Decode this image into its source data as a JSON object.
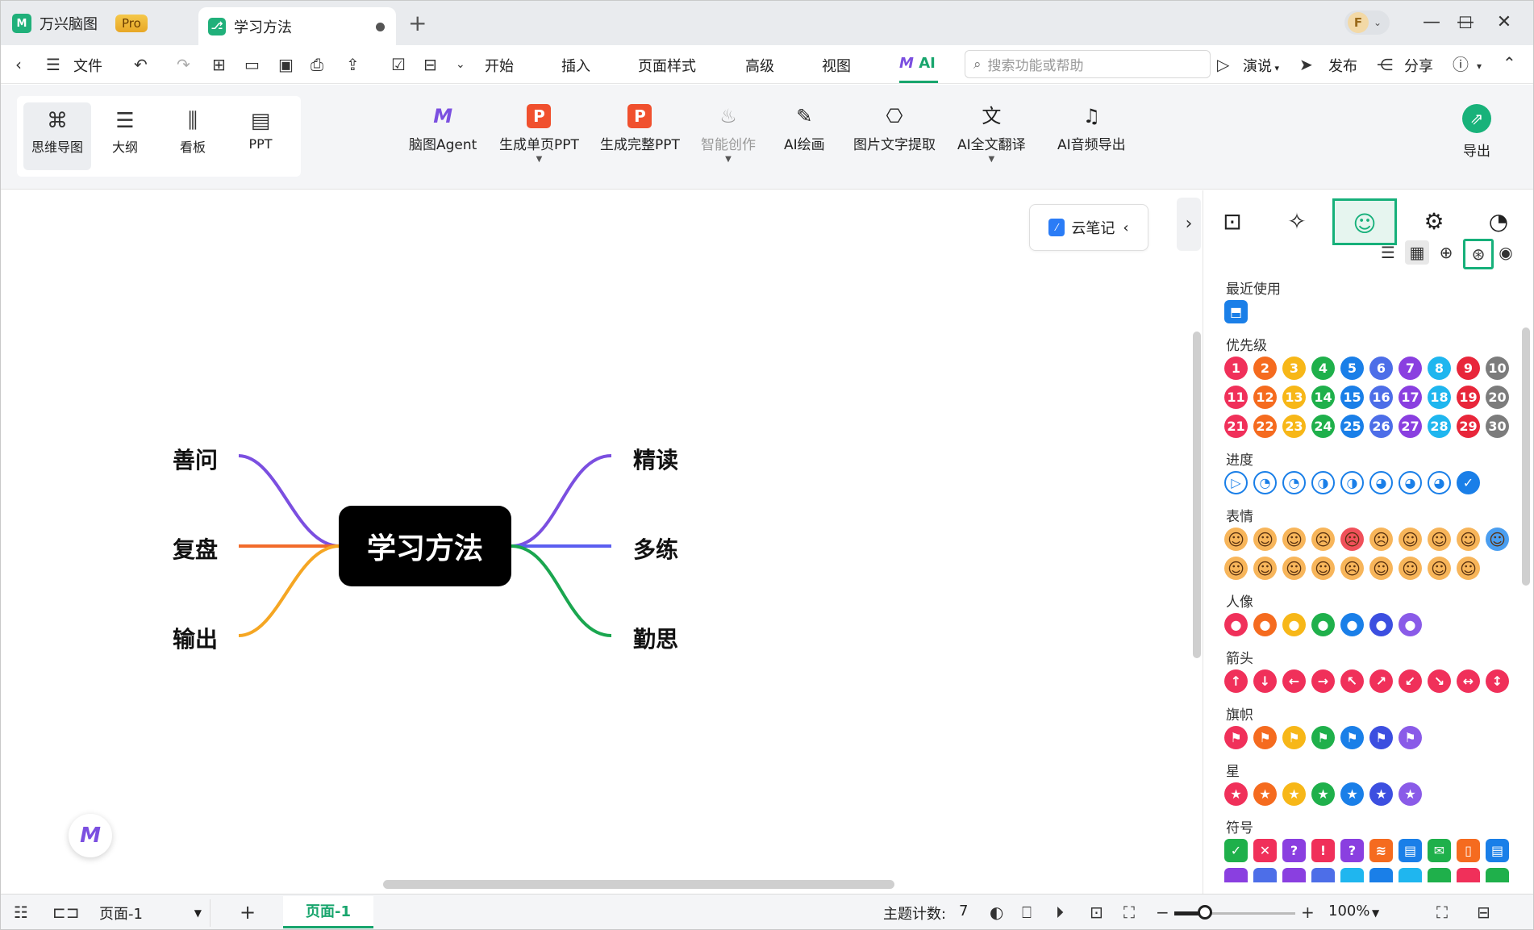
{
  "titlebar": {
    "app_tab_label": "万兴脑图",
    "pro_badge": "Pro",
    "doc_tab_label": "学习方法",
    "avatar_letter": "F",
    "new_tab": "+",
    "minimize": "—",
    "maximize": "☐",
    "close": "✕"
  },
  "menubar": {
    "file": "文件",
    "items": [
      "开始",
      "插入",
      "页面样式",
      "高级",
      "视图"
    ],
    "ai_tab": "AI",
    "search_placeholder": "搜索功能或帮助",
    "present": "演说",
    "publish": "发布",
    "share": "分享"
  },
  "ribbon": {
    "views": [
      "思维导图",
      "大纲",
      "看板",
      "PPT"
    ],
    "tools": [
      "脑图Agent",
      "生成单页PPT",
      "生成完整PPT",
      "智能创作",
      "AI绘画",
      "图片文字提取",
      "AI全文翻译",
      "AI音频导出"
    ],
    "export": "导出"
  },
  "canvas": {
    "cloud_notes": "云笔记",
    "central_topic": "学习方法",
    "left_nodes": [
      "善问",
      "复盘",
      "输出"
    ],
    "right_nodes": [
      "精读",
      "多练",
      "勤思"
    ],
    "branch_colors": {
      "善问": "#7b4fe0",
      "复盘": "#f26b2a",
      "输出": "#f5a623",
      "精读": "#7b4fe0",
      "多练": "#5b5ef0",
      "勤思": "#1aa64f"
    }
  },
  "panel": {
    "sections": {
      "recent": "最近使用",
      "priority": "优先级",
      "progress": "进度",
      "emotion": "表情",
      "person": "人像",
      "arrow": "箭头",
      "flag": "旗帜",
      "star": "星",
      "symbol": "符号"
    },
    "priority_numbers": [
      "1",
      "2",
      "3",
      "4",
      "5",
      "6",
      "7",
      "8",
      "9",
      "10",
      "11",
      "12",
      "13",
      "14",
      "15",
      "16",
      "17",
      "18",
      "19",
      "20",
      "21",
      "22",
      "23",
      "24",
      "25",
      "26",
      "27",
      "28",
      "29",
      "30"
    ],
    "priority_colors": [
      "#f0305a",
      "#f56b1f",
      "#f7b718",
      "#1fb04b",
      "#1a7fe8",
      "#4d6ee8",
      "#8a3fe0",
      "#1fb6ef",
      "#e8263a",
      "#7c7c7c"
    ],
    "series_colors": [
      "#f0305a",
      "#f56b1f",
      "#f7b718",
      "#1fb04b",
      "#1a7fe8",
      "#3c4fe0",
      "#8a5be8"
    ]
  },
  "status": {
    "page_select": "页面-1",
    "page_tab": "页面-1",
    "topic_count_label": "主题计数:",
    "topic_count": "7",
    "zoom": "100%",
    "zoom_fraction": 0.25
  }
}
